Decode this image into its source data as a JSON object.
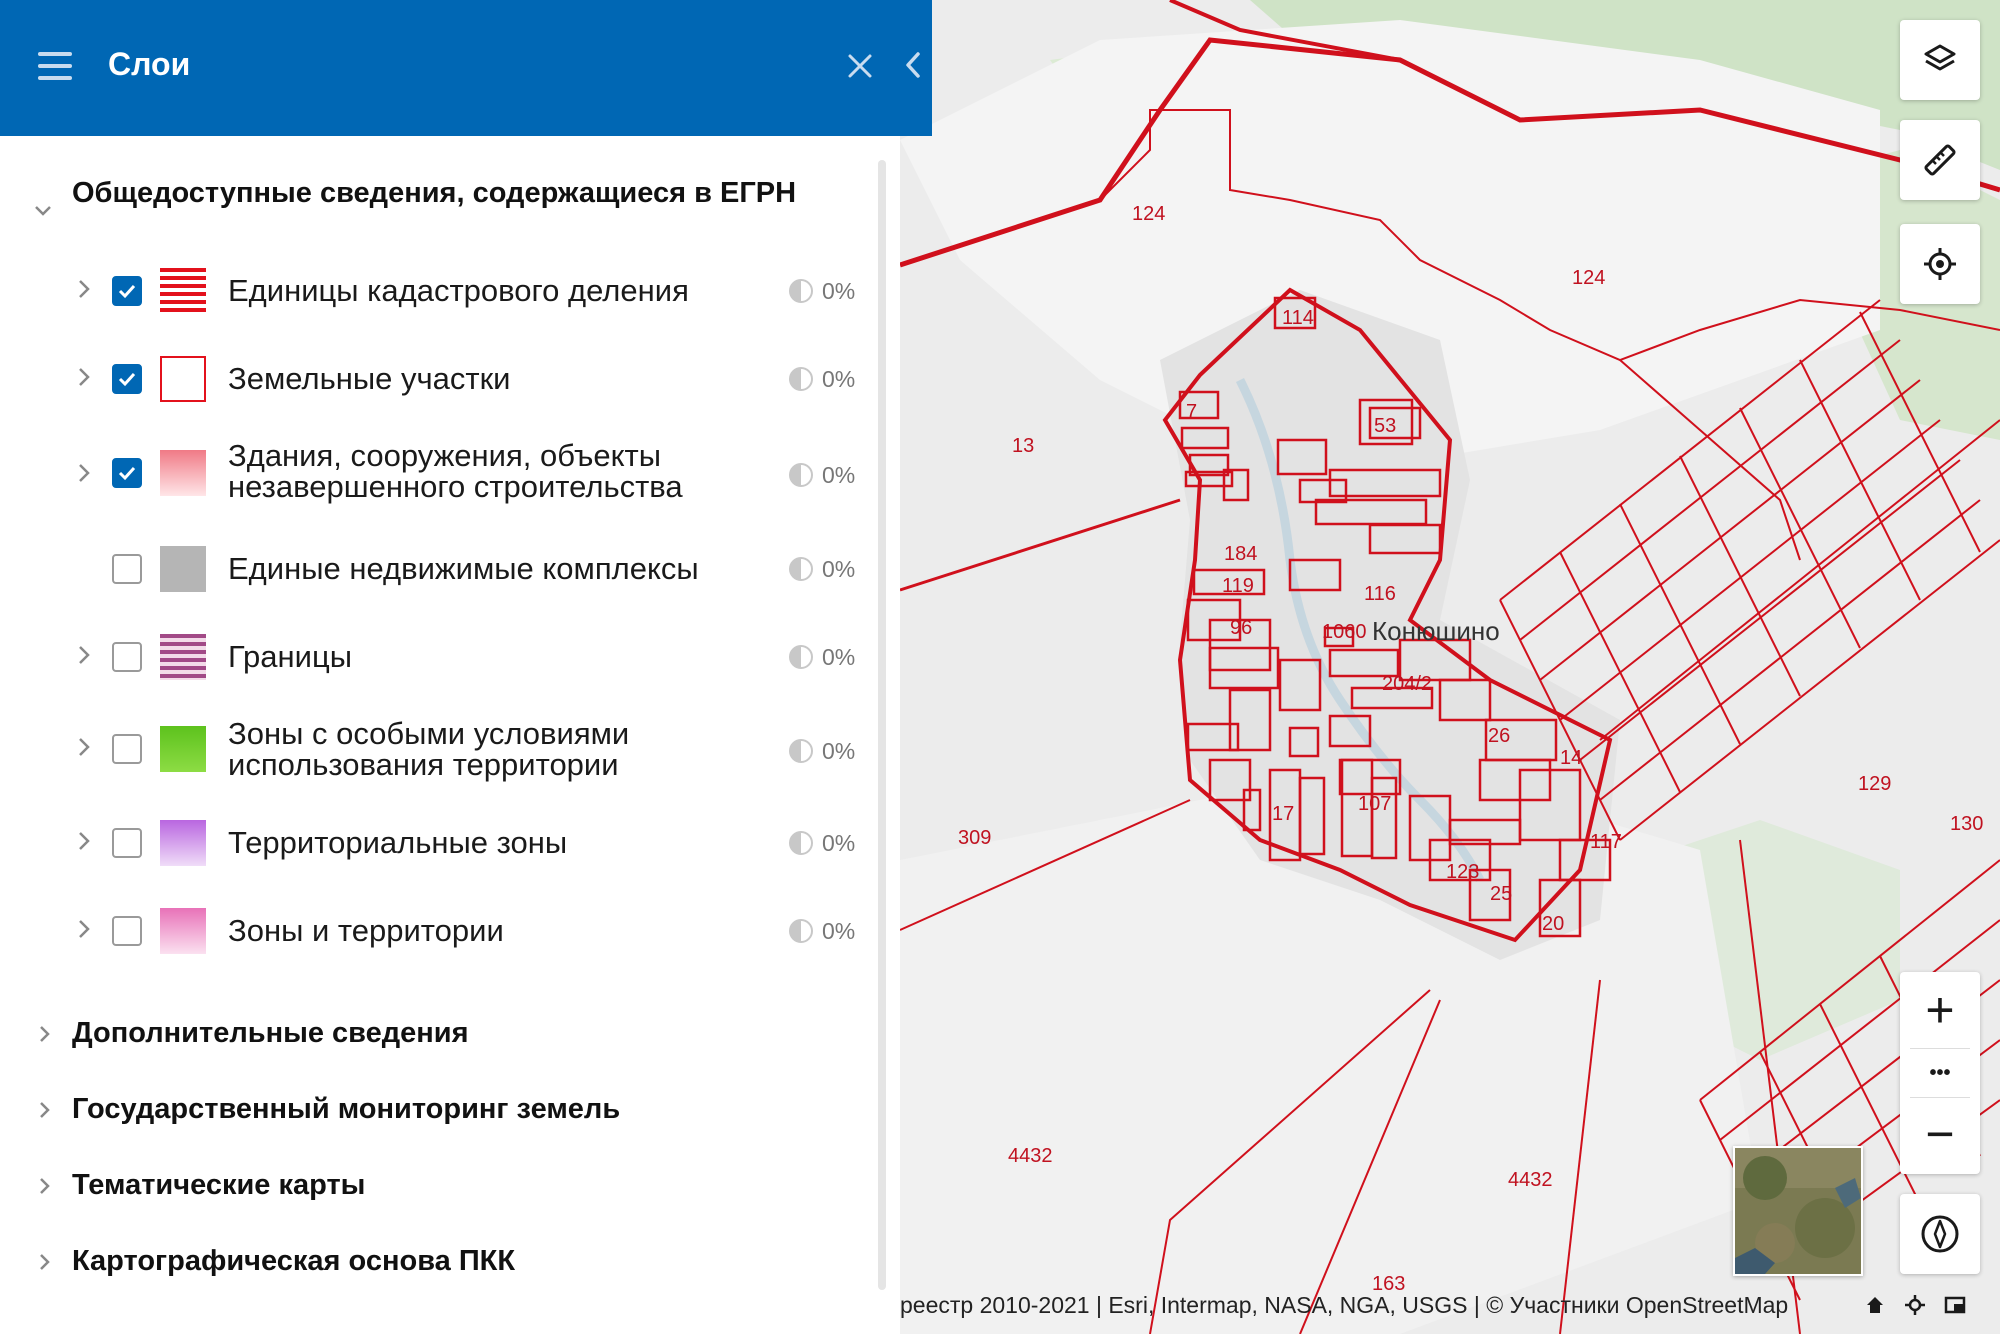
{
  "panel": {
    "title": "Слои",
    "groups": [
      {
        "label": "Общедоступные сведения, содержащиеся в ЕГРН",
        "expanded": true,
        "layers": [
          {
            "label": "Единицы кадастрового деления",
            "checked": true,
            "opacity": "0%",
            "swatch": "stripes-red"
          },
          {
            "label": "Земельные участки",
            "checked": true,
            "opacity": "0%",
            "swatch": "outline-red"
          },
          {
            "label_line1": "Здания, сооружения, объекты",
            "label_line2": "незавершенного строительства",
            "checked": true,
            "opacity": "0%",
            "swatch": "gradient-pink"
          },
          {
            "label": "Единые недвижимые комплексы",
            "checked": false,
            "opacity": "0%",
            "swatch": "grey"
          },
          {
            "label": "Границы",
            "checked": false,
            "opacity": "0%",
            "swatch": "stripes-purple"
          },
          {
            "label_line1": "Зоны с особыми условиями",
            "label_line2": "использования территории",
            "checked": false,
            "opacity": "0%",
            "swatch": "green"
          },
          {
            "label": "Территориальные зоны",
            "checked": false,
            "opacity": "0%",
            "swatch": "gradient-violet"
          },
          {
            "label": "Зоны и территории",
            "checked": false,
            "opacity": "0%",
            "swatch": "gradient-magenta"
          }
        ]
      },
      {
        "label": "Дополнительные сведения",
        "expanded": false
      },
      {
        "label": "Государственный мониторинг земель",
        "expanded": false
      },
      {
        "label": "Тематические карты",
        "expanded": false
      },
      {
        "label": "Картографическая основа ПКК",
        "expanded": false
      }
    ]
  },
  "map": {
    "place_name": "Конюшино",
    "parcel_labels": [
      "124",
      "124",
      "13",
      "114",
      "53",
      "7",
      "184",
      "119",
      "96",
      "116",
      "1060",
      "204/2",
      "26",
      "14",
      "309",
      "107",
      "17",
      "123",
      "25",
      "117",
      "20",
      "129",
      "130",
      "4432",
      "4432",
      "163"
    ]
  },
  "controls": {
    "layers_icon": "layers-icon",
    "measure_icon": "ruler-icon",
    "locate_icon": "locate-icon",
    "zoom_in": "+",
    "more": "•••",
    "zoom_out": "−",
    "compass_icon": "compass-icon"
  },
  "attribution": {
    "text": "реестр 2010-2021 | Esri, Intermap, NASA, NGA, USGS | © Участники OpenStreetMap"
  },
  "colors": {
    "header": "#0067b4",
    "checkbox_on": "#0067b4",
    "parcel_line": "#d0101c"
  }
}
